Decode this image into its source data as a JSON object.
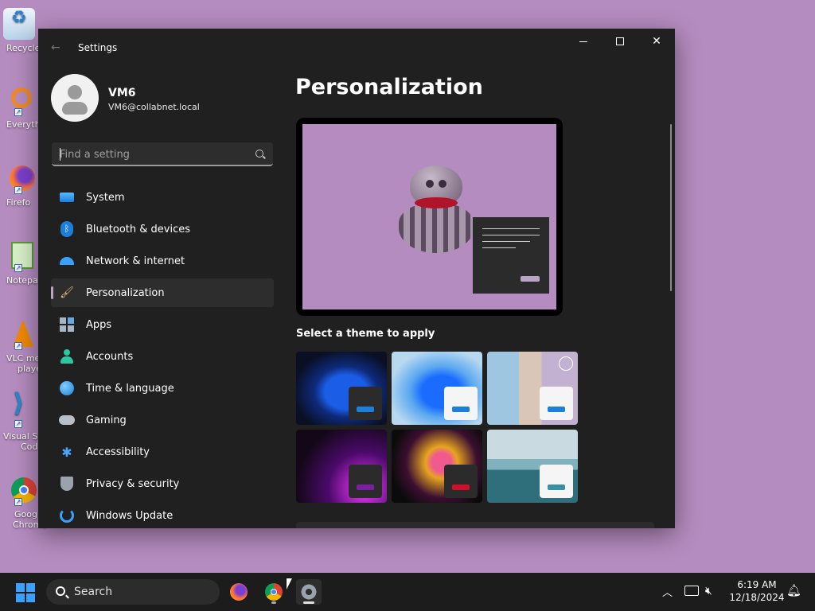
{
  "desktop": {
    "icons": [
      {
        "label": "Recycle",
        "icon": "recycle-bin-icon",
        "color": "#cfe2f3"
      },
      {
        "label": "Everyth",
        "icon": "everything-search-icon",
        "color": "#f08a24"
      },
      {
        "label": "Firefo",
        "icon": "firefox-icon",
        "color": "#ff7139"
      },
      {
        "label": "Notepa",
        "icon": "notepad-icon",
        "color": "#7bbf4a"
      },
      {
        "label": "VLC me",
        "label2": "playe",
        "icon": "vlc-icon",
        "color": "#f08a00"
      },
      {
        "label": "Visual St",
        "label2": "Cod",
        "icon": "vscode-icon",
        "color": "#1f8ad2"
      },
      {
        "label": "Goog",
        "label2": "Chrome",
        "icon": "chrome-icon",
        "color": "#db4437"
      }
    ]
  },
  "window": {
    "title": "Settings",
    "controls": {
      "minimize": "minimize",
      "maximize": "maximize",
      "close": "✕"
    }
  },
  "profile": {
    "name": "VM6",
    "email": "VM6@collabnet.local"
  },
  "search": {
    "placeholder": "Find a setting"
  },
  "nav": {
    "items": [
      {
        "label": "System",
        "icon": "monitor-icon"
      },
      {
        "label": "Bluetooth & devices",
        "icon": "bluetooth-icon"
      },
      {
        "label": "Network & internet",
        "icon": "wifi-icon"
      },
      {
        "label": "Personalization",
        "icon": "brush-icon",
        "active": true
      },
      {
        "label": "Apps",
        "icon": "apps-icon"
      },
      {
        "label": "Accounts",
        "icon": "person-icon"
      },
      {
        "label": "Time & language",
        "icon": "globe-clock-icon"
      },
      {
        "label": "Gaming",
        "icon": "gamepad-icon"
      },
      {
        "label": "Accessibility",
        "icon": "accessibility-icon"
      },
      {
        "label": "Privacy & security",
        "icon": "shield-icon"
      },
      {
        "label": "Windows Update",
        "icon": "update-icon"
      }
    ]
  },
  "content": {
    "title": "Personalization",
    "themes_label": "Select a theme to apply",
    "themes": [
      {
        "name": "windows-dark",
        "accent": "#1e7fd8",
        "badge": "dark"
      },
      {
        "name": "windows-light",
        "accent": "#1e7fd8",
        "badge": "light"
      },
      {
        "name": "windows-spotlight",
        "accent": "#1e7fd8",
        "badge": "light",
        "selected_ring": true
      },
      {
        "name": "glow",
        "accent": "#7a1fa2",
        "badge": "dark"
      },
      {
        "name": "captured-motion",
        "accent": "#d0102a",
        "badge": "dark"
      },
      {
        "name": "flow",
        "accent": "#3a8fa8",
        "badge": "light"
      }
    ]
  },
  "taskbar": {
    "search_label": "Search",
    "time": "6:19 AM",
    "date": "12/18/2024",
    "accent": "#3aa0ff"
  }
}
